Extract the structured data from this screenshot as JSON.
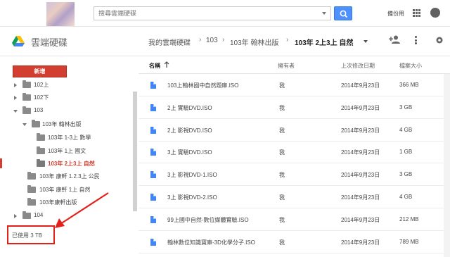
{
  "header": {
    "search_placeholder": "搜尋雲端硬碟",
    "backup_label": "備份用"
  },
  "drive": {
    "title": "雲端硬碟"
  },
  "breadcrumb": [
    "我的雲端硬碟",
    "103",
    "103年 翰林出版",
    "103年 2上3上 自然"
  ],
  "sidebar": {
    "new_label": "新增",
    "tree": [
      {
        "label": "102上",
        "expanded": false
      },
      {
        "label": "102下",
        "expanded": false
      },
      {
        "label": "103",
        "expanded": true
      },
      {
        "label": "103年 翰林出版",
        "expanded": true
      },
      {
        "label": "103年 1-3上 數學"
      },
      {
        "label": "103年 1上 國文"
      },
      {
        "label": "103年 2上3上 自然",
        "selected": true
      },
      {
        "label": "103年 康軒 1.2.3上 公民"
      },
      {
        "label": "103年 康軒 1上 自然"
      },
      {
        "label": "103年康軒出版"
      },
      {
        "label": "104",
        "expanded": false
      }
    ],
    "storage_used": "已使用 3 TB"
  },
  "columns": {
    "name": "名稱",
    "owner": "擁有者",
    "modified": "上次修改日期",
    "size": "檔案大小"
  },
  "files": [
    {
      "name": "103上翰林國中自然題庫.ISO",
      "owner": "我",
      "modified": "2014年9月23日",
      "size": "366 MB"
    },
    {
      "name": "2上 實驗DVD.ISO",
      "owner": "我",
      "modified": "2014年9月23日",
      "size": "3 GB"
    },
    {
      "name": "2上 影視DVD.ISO",
      "owner": "我",
      "modified": "2014年9月23日",
      "size": "4 GB"
    },
    {
      "name": "3上 實驗DVD.ISO",
      "owner": "我",
      "modified": "2014年9月23日",
      "size": "1 GB"
    },
    {
      "name": "3上 影視DVD-1.ISO",
      "owner": "我",
      "modified": "2014年9月23日",
      "size": "3 GB"
    },
    {
      "name": "3上 影視DVD-2.ISO",
      "owner": "我",
      "modified": "2014年9月23日",
      "size": "4 GB"
    },
    {
      "name": "99上國中自然-數位媒體實驗.ISO",
      "owner": "我",
      "modified": "2014年9月23日",
      "size": "212 MB"
    },
    {
      "name": "翰林數位知識寶庫-3D化學分子.ISO",
      "owner": "我",
      "modified": "2014年9月23日",
      "size": "789 MB"
    }
  ],
  "colors": {
    "accent_red": "#d23f31",
    "search_blue": "#4d90fe",
    "file_icon_blue": "#4285f4",
    "annotation_red": "#e4201b"
  }
}
